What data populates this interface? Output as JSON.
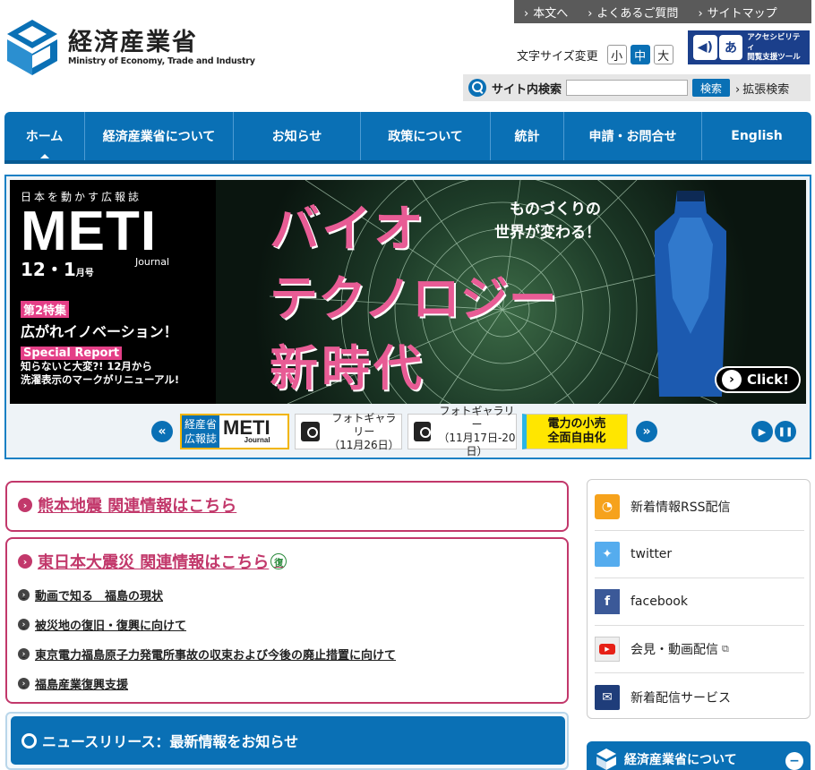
{
  "util_links": [
    "本文へ",
    "よくあるご質問",
    "サイトマップ"
  ],
  "logo": {
    "jp": "経済産業省",
    "en": "Ministry of Economy, Trade and Industry"
  },
  "font_size": {
    "label": "文字サイズ変更",
    "options": [
      "小",
      "中",
      "大"
    ],
    "selected": "中"
  },
  "accessibility": {
    "line1": "アクセシビリティ",
    "line2": "閲覧支援ツール",
    "icon_text": "あ"
  },
  "search": {
    "label": "サイト内検索",
    "button": "検索",
    "advanced": "拡張検索",
    "placeholder": ""
  },
  "nav": [
    {
      "label": "ホーム",
      "active": true
    },
    {
      "label": "経済産業省について"
    },
    {
      "label": "お知らせ"
    },
    {
      "label": "政策について"
    },
    {
      "label": "統計"
    },
    {
      "label": "申請・お問合せ"
    },
    {
      "label": "English"
    }
  ],
  "banner": {
    "tagline": "日本を動かす広報誌",
    "meti": "METI",
    "journal": "Journal",
    "issue": "12・1",
    "issue_unit": "月号",
    "feature_tag": "第2特集",
    "feature_text": "広がれイノベーション！",
    "report_tag": "Special Report",
    "report_text1": "知らないと大変?! 12月から",
    "report_text2": "洗濯表示のマークがリニューアル!",
    "title1": "バイオ",
    "title2": "テクノロジー",
    "title3": "新時代",
    "subtitle1": "ものづくりの",
    "subtitle2": "世界が変わる！",
    "click": "Click!"
  },
  "thumbs": {
    "meti_tag1": "経産省",
    "meti_tag2": "広報誌",
    "meti_big": "METI",
    "meti_small": "Journal",
    "photo1_l1": "フォトギャラリー",
    "photo1_l2": "（11月26日）",
    "photo2_l1": "フォトギャラリー",
    "photo2_l2": "（11月17日-20日）",
    "power_l1": "電力の小売",
    "power_l2": "全面自由化"
  },
  "kumamoto": {
    "title": "熊本地震 関連情報はこちら"
  },
  "tohoku": {
    "title": "東日本大震災 関連情報はこちら",
    "badge": "復",
    "items": [
      "動画で知る　福島の現状",
      "被災地の復旧・復興に向けて",
      "東京電力福島原子力発電所事故の収束および今後の廃止措置に向けて",
      "福島産業復興支援"
    ]
  },
  "news": {
    "title": "ニュースリリース：最新情報をお知らせ"
  },
  "side": [
    {
      "label": "新着情報RSS配信",
      "icon": "rss-icon"
    },
    {
      "label": "twitter",
      "icon": "twitter-icon"
    },
    {
      "label": "facebook",
      "icon": "facebook-icon"
    },
    {
      "label": "会見・動画配信",
      "icon": "youtube-icon"
    },
    {
      "label": "新着配信サービス",
      "icon": "mail-icon"
    }
  ],
  "side2": {
    "title": "経済産業省について"
  },
  "colors": {
    "brand": "#0a70b5",
    "pink": "#c2386b"
  }
}
